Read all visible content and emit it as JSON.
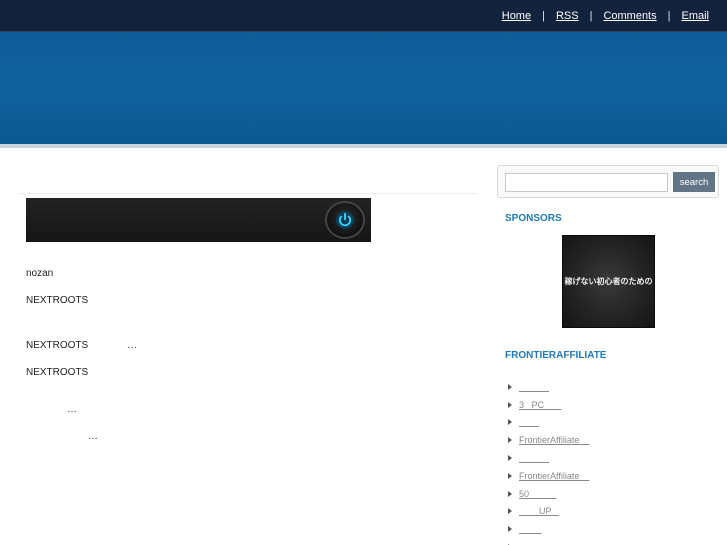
{
  "topnav": {
    "items": [
      {
        "label": "Home",
        "sep": "|"
      },
      {
        "label": "RSS",
        "sep": "|"
      },
      {
        "label": "Comments",
        "sep": "|"
      },
      {
        "label": "Email",
        "sep": ""
      }
    ]
  },
  "post": {
    "promo_icon": "power-icon",
    "lines": [
      {
        "text": "nozan"
      },
      {
        "text": "NEXTROOTS"
      },
      {
        "text": "NEXTROOTS              …"
      },
      {
        "text": "NEXTROOTS"
      },
      {
        "text": "…"
      },
      {
        "text": "…"
      }
    ]
  },
  "sidebar": {
    "search": {
      "value": "",
      "placeholder": "",
      "button_label": "search"
    },
    "sponsors": {
      "heading": "SPONSORS",
      "image_text": "稼げない初心者のための"
    },
    "frontier": {
      "heading": "FRONTIERAFFILIATE",
      "items": [
        {
          "label": "            "
        },
        {
          "label": "3   PC       "
        },
        {
          "label": "        "
        },
        {
          "label": "FrontierAffiliate    "
        },
        {
          "label": "            "
        },
        {
          "label": "FrontierAffiliate    "
        },
        {
          "label": "50           "
        },
        {
          "label": "        UP   "
        },
        {
          "label": "         "
        },
        {
          "label": ""
        }
      ]
    }
  },
  "colors": {
    "topbar": "#13223d",
    "banner": "#10629f",
    "sidebar_heading": "#1e7ab8",
    "search_button": "#627587",
    "link_gray": "#888888"
  }
}
